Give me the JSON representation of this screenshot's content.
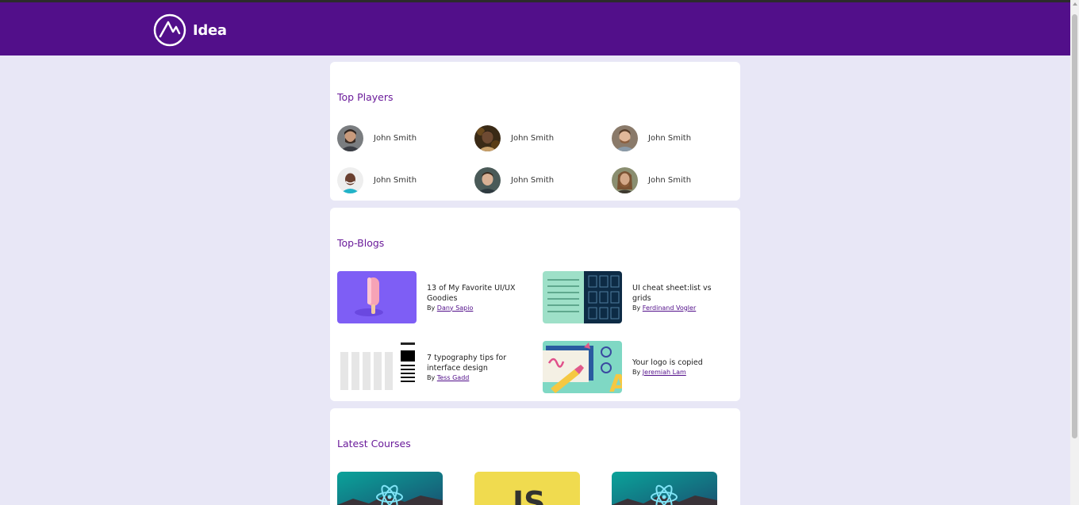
{
  "app": {
    "name": "Idea"
  },
  "colors": {
    "header": "#520f8a",
    "accent": "#6a1b9a",
    "background": "#e8e7f6"
  },
  "top_players": {
    "title": "Top Players",
    "players": [
      {
        "name": "John Smith",
        "icon": "avatar-icon"
      },
      {
        "name": "John Smith",
        "icon": "avatar-icon"
      },
      {
        "name": "John Smith",
        "icon": "avatar-icon"
      },
      {
        "name": "John Smith",
        "icon": "avatar-icon"
      },
      {
        "name": "John Smith",
        "icon": "avatar-icon"
      },
      {
        "name": "John Smith",
        "icon": "avatar-icon"
      }
    ]
  },
  "top_blogs": {
    "title": "Top-Blogs",
    "blogs": [
      {
        "title": "13 of My Favorite UI/UX Goodies",
        "by": "By",
        "author": "Dany Sapio"
      },
      {
        "title": "UI cheat sheet:list vs grids",
        "by": "By",
        "author": "Ferdinand Vogler"
      },
      {
        "title": "7 typography tips for interface design",
        "by": "By",
        "author": "Tess Gadd"
      },
      {
        "title": "Your logo is copied",
        "by": "By",
        "author": "Jeremiah Lam"
      }
    ]
  },
  "latest_courses": {
    "title": "Latest Courses",
    "courses": [
      {
        "icon": "react-icon"
      },
      {
        "icon": "javascript-icon",
        "label": "JS"
      },
      {
        "icon": "react-icon"
      }
    ]
  }
}
